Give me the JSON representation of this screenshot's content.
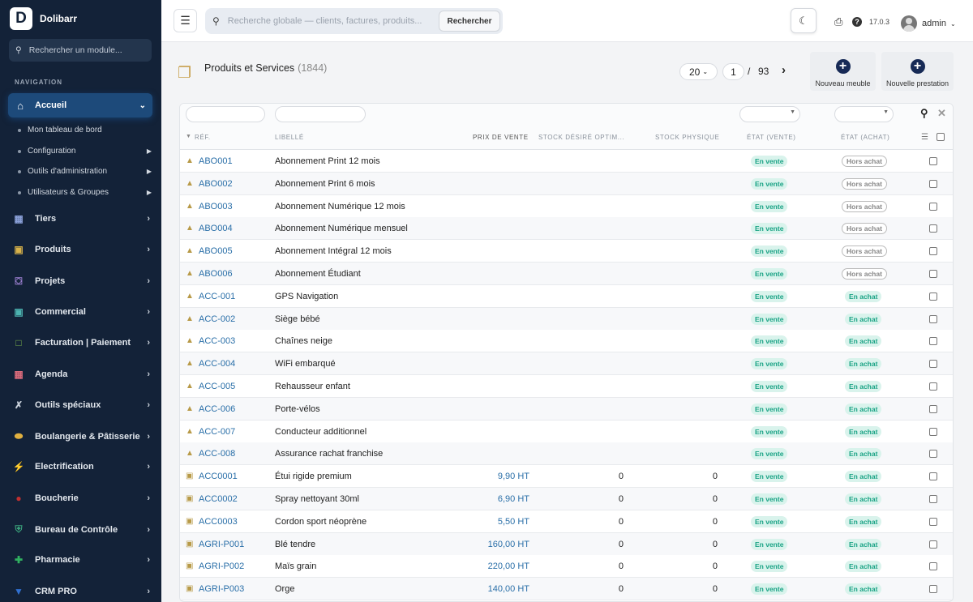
{
  "app": {
    "logo_letter": "D",
    "name": "Dolibarr",
    "version": "17.0.3"
  },
  "sidebar": {
    "search_placeholder": "Rechercher un module...",
    "section_label": "NAVIGATION",
    "active": {
      "label": "Accueil",
      "icon": "home-icon"
    },
    "subitems": [
      {
        "label": "Mon tableau de bord",
        "has_arrow": false
      },
      {
        "label": "Configuration",
        "has_arrow": true
      },
      {
        "label": "Outils d'administration",
        "has_arrow": true
      },
      {
        "label": "Utilisateurs & Groupes",
        "has_arrow": true
      }
    ],
    "items": [
      {
        "label": "Tiers",
        "icon": "building-icon",
        "color": "#8aa0d8"
      },
      {
        "label": "Produits",
        "icon": "box-icon",
        "color": "#d8b24a"
      },
      {
        "label": "Projets",
        "icon": "project-icon",
        "color": "#9b7fd0"
      },
      {
        "label": "Commercial",
        "icon": "briefcase-icon",
        "color": "#4cb3b0"
      },
      {
        "label": "Facturation | Paiement",
        "icon": "invoice-icon",
        "color": "#7ab04c"
      },
      {
        "label": "Agenda",
        "icon": "calendar-icon",
        "color": "#d86a7a"
      },
      {
        "label": "Outils spéciaux",
        "icon": "tools-icon",
        "color": "#c8d0da"
      },
      {
        "label": "Boulangerie & Pâtisserie",
        "icon": "bread-icon",
        "color": "#e0b040"
      },
      {
        "label": "Electrification",
        "icon": "bolt-icon",
        "color": "#f0c020"
      },
      {
        "label": "Boucherie",
        "icon": "meat-icon",
        "color": "#c03030"
      },
      {
        "label": "Bureau de Contrôle",
        "icon": "shield-icon",
        "color": "#3aa07a"
      },
      {
        "label": "Pharmacie",
        "icon": "cross-icon",
        "color": "#30b060"
      },
      {
        "label": "CRM PRO",
        "icon": "funnel-icon",
        "color": "#3070d0"
      }
    ]
  },
  "topbar": {
    "search_placeholder": "Recherche globale — clients, factures, produits...",
    "search_button": "Rechercher",
    "user": "admin"
  },
  "page": {
    "title": "Produits et Services",
    "count": "(1844)",
    "per_page": "20",
    "current_page": "1",
    "page_sep": "/",
    "total_pages": "93",
    "btn_new_product": "Nouveau meuble",
    "btn_new_service": "Nouvelle prestation"
  },
  "table": {
    "headers": {
      "ref": "RÉF.",
      "label": "LIBELLÉ",
      "price": "PRIX DE VENTE",
      "stock_desired": "STOCK DÉSIRÉ OPTIM...",
      "stock_physical": "STOCK PHYSIQUE",
      "state_sell": "ÉTAT (VENTE)",
      "state_buy": "ÉTAT (ACHAT)"
    },
    "rows": [
      {
        "type": "service",
        "ref": "ABO001",
        "label": "Abonnement Print 12 mois",
        "price": "",
        "stock_desired": "",
        "stock_physical": "",
        "sell": "En vente",
        "buy": "Hors achat"
      },
      {
        "type": "service",
        "ref": "ABO002",
        "label": "Abonnement Print 6 mois",
        "price": "",
        "stock_desired": "",
        "stock_physical": "",
        "sell": "En vente",
        "buy": "Hors achat"
      },
      {
        "type": "service",
        "ref": "ABO003",
        "label": "Abonnement Numérique 12 mois",
        "price": "",
        "stock_desired": "",
        "stock_physical": "",
        "sell": "En vente",
        "buy": "Hors achat"
      },
      {
        "type": "service",
        "ref": "ABO004",
        "label": "Abonnement Numérique mensuel",
        "price": "",
        "stock_desired": "",
        "stock_physical": "",
        "sell": "En vente",
        "buy": "Hors achat"
      },
      {
        "type": "service",
        "ref": "ABO005",
        "label": "Abonnement Intégral 12 mois",
        "price": "",
        "stock_desired": "",
        "stock_physical": "",
        "sell": "En vente",
        "buy": "Hors achat"
      },
      {
        "type": "service",
        "ref": "ABO006",
        "label": "Abonnement Étudiant",
        "price": "",
        "stock_desired": "",
        "stock_physical": "",
        "sell": "En vente",
        "buy": "Hors achat"
      },
      {
        "type": "service",
        "ref": "ACC-001",
        "label": "GPS Navigation",
        "price": "",
        "stock_desired": "",
        "stock_physical": "",
        "sell": "En vente",
        "buy": "En achat"
      },
      {
        "type": "service",
        "ref": "ACC-002",
        "label": "Siège bébé",
        "price": "",
        "stock_desired": "",
        "stock_physical": "",
        "sell": "En vente",
        "buy": "En achat"
      },
      {
        "type": "service",
        "ref": "ACC-003",
        "label": "Chaînes neige",
        "price": "",
        "stock_desired": "",
        "stock_physical": "",
        "sell": "En vente",
        "buy": "En achat"
      },
      {
        "type": "service",
        "ref": "ACC-004",
        "label": "WiFi embarqué",
        "price": "",
        "stock_desired": "",
        "stock_physical": "",
        "sell": "En vente",
        "buy": "En achat"
      },
      {
        "type": "service",
        "ref": "ACC-005",
        "label": "Rehausseur enfant",
        "price": "",
        "stock_desired": "",
        "stock_physical": "",
        "sell": "En vente",
        "buy": "En achat"
      },
      {
        "type": "service",
        "ref": "ACC-006",
        "label": "Porte-vélos",
        "price": "",
        "stock_desired": "",
        "stock_physical": "",
        "sell": "En vente",
        "buy": "En achat"
      },
      {
        "type": "service",
        "ref": "ACC-007",
        "label": "Conducteur additionnel",
        "price": "",
        "stock_desired": "",
        "stock_physical": "",
        "sell": "En vente",
        "buy": "En achat"
      },
      {
        "type": "service",
        "ref": "ACC-008",
        "label": "Assurance rachat franchise",
        "price": "",
        "stock_desired": "",
        "stock_physical": "",
        "sell": "En vente",
        "buy": "En achat"
      },
      {
        "type": "product",
        "ref": "ACC0001",
        "label": "Étui rigide premium",
        "price": "9,90 HT",
        "stock_desired": "0",
        "stock_physical": "0",
        "sell": "En vente",
        "buy": "En achat"
      },
      {
        "type": "product",
        "ref": "ACC0002",
        "label": "Spray nettoyant 30ml",
        "price": "6,90 HT",
        "stock_desired": "0",
        "stock_physical": "0",
        "sell": "En vente",
        "buy": "En achat"
      },
      {
        "type": "product",
        "ref": "ACC0003",
        "label": "Cordon sport néoprène",
        "price": "5,50 HT",
        "stock_desired": "0",
        "stock_physical": "0",
        "sell": "En vente",
        "buy": "En achat"
      },
      {
        "type": "product",
        "ref": "AGRI-P001",
        "label": "Blé tendre",
        "price": "160,00 HT",
        "stock_desired": "0",
        "stock_physical": "0",
        "sell": "En vente",
        "buy": "En achat"
      },
      {
        "type": "product",
        "ref": "AGRI-P002",
        "label": "Maïs grain",
        "price": "220,00 HT",
        "stock_desired": "0",
        "stock_physical": "0",
        "sell": "En vente",
        "buy": "En achat"
      },
      {
        "type": "product",
        "ref": "AGRI-P003",
        "label": "Orge",
        "price": "140,00 HT",
        "stock_desired": "0",
        "stock_physical": "0",
        "sell": "En vente",
        "buy": "En achat"
      }
    ]
  }
}
